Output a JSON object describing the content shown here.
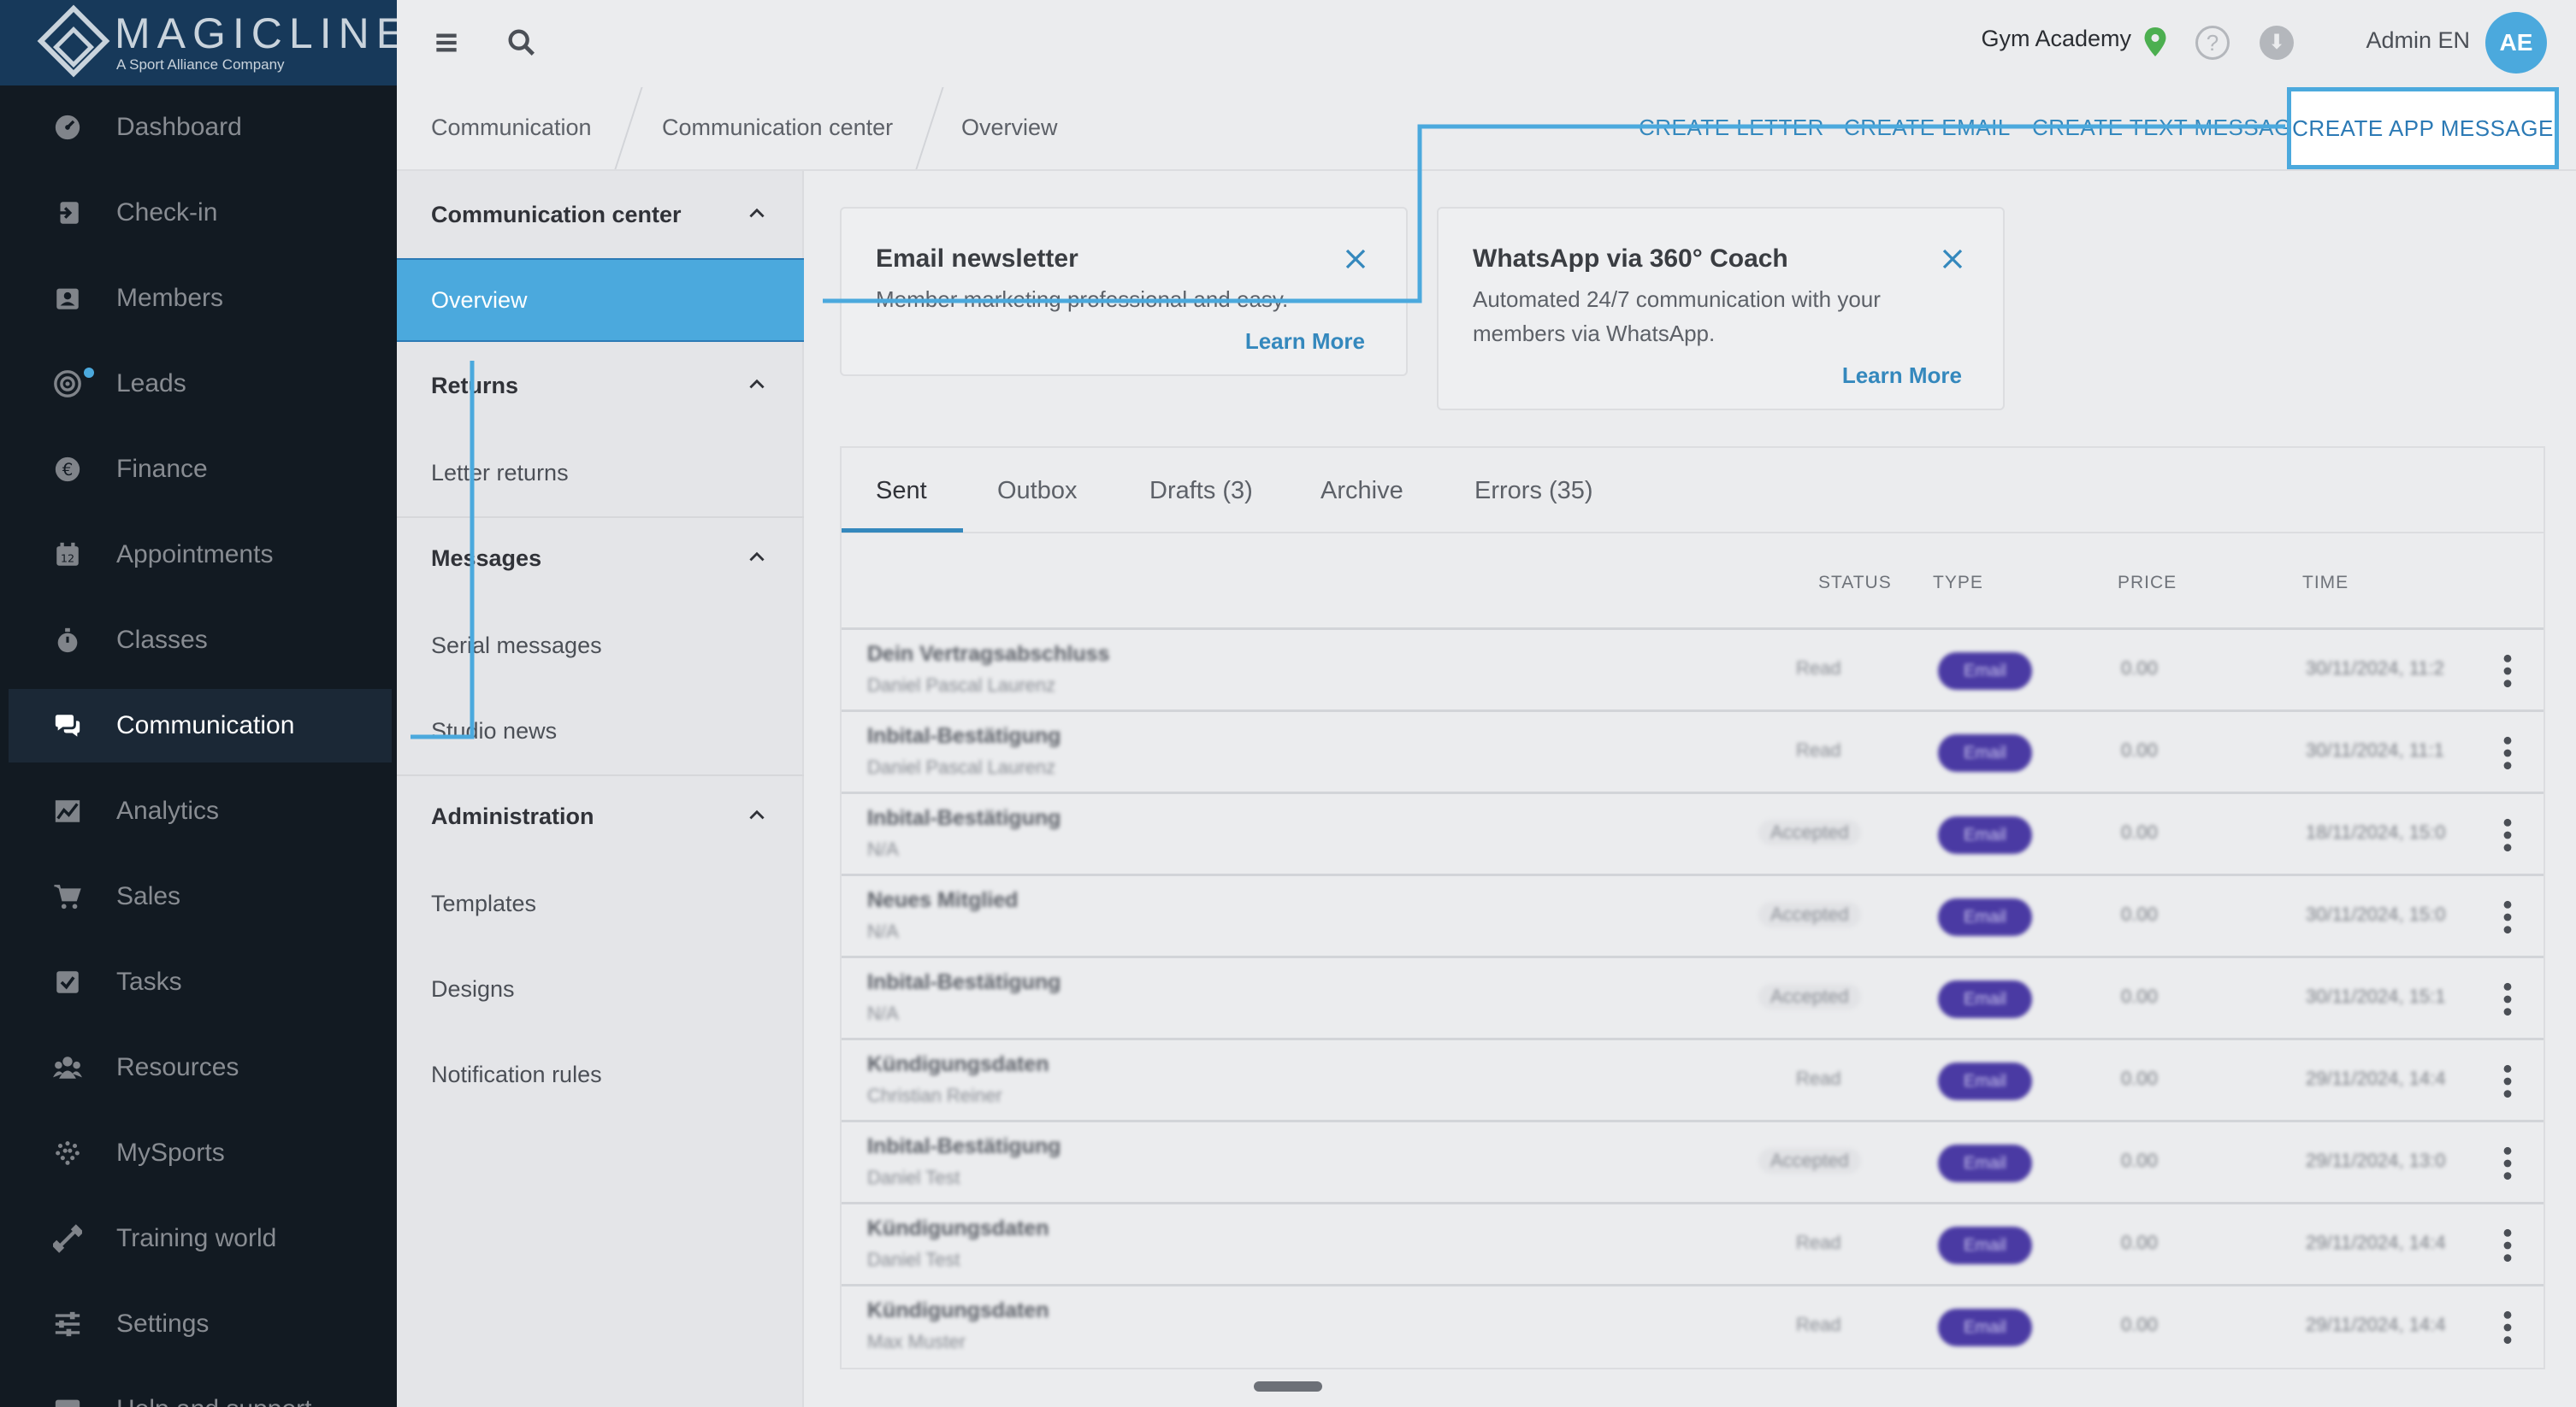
{
  "app": {
    "logo_name": "MAGICLINE",
    "logo_tagline": "A Sport Alliance Company"
  },
  "sidebar": {
    "items": [
      {
        "label": "Dashboard",
        "icon": "dashboard-icon"
      },
      {
        "label": "Check-in",
        "icon": "check-in-icon"
      },
      {
        "label": "Members",
        "icon": "members-icon"
      },
      {
        "label": "Leads",
        "icon": "leads-icon"
      },
      {
        "label": "Finance",
        "icon": "euro-icon"
      },
      {
        "label": "Appointments",
        "icon": "calendar-icon"
      },
      {
        "label": "Classes",
        "icon": "stopwatch-icon"
      },
      {
        "label": "Communication",
        "icon": "chat-icon"
      },
      {
        "label": "Analytics",
        "icon": "chart-icon"
      },
      {
        "label": "Sales",
        "icon": "cart-icon"
      },
      {
        "label": "Tasks",
        "icon": "checkbox-icon"
      },
      {
        "label": "Resources",
        "icon": "people-icon"
      },
      {
        "label": "MySports",
        "icon": "dots-grid-icon"
      },
      {
        "label": "Training world",
        "icon": "dumbbell-icon"
      },
      {
        "label": "Settings",
        "icon": "sliders-icon"
      },
      {
        "label": "Help and support",
        "icon": "help-icon"
      }
    ],
    "active": "Communication"
  },
  "topbar": {
    "studio": "Gym Academy",
    "user": "Admin EN",
    "avatar_initials": "AE",
    "help_glyph": "?",
    "download_glyph": "⬇"
  },
  "breadcrumb": [
    "Communication",
    "Communication center",
    "Overview"
  ],
  "actions": {
    "create_letter": "CREATE LETTER",
    "create_email": "CREATE EMAIL",
    "create_text": "CREATE TEXT MESSAGE",
    "create_app": "CREATE APP MESSAGE"
  },
  "subnav": {
    "sections": [
      {
        "title": "Communication center",
        "items": [
          "Overview"
        ]
      },
      {
        "title": "Returns",
        "items": [
          "Letter returns"
        ]
      },
      {
        "title": "Messages",
        "items": [
          "Serial messages",
          "Studio news"
        ]
      },
      {
        "title": "Administration",
        "items": [
          "Templates",
          "Designs",
          "Notification rules"
        ]
      }
    ],
    "selected": "Overview"
  },
  "cards": [
    {
      "title": "Email newsletter",
      "body": "Member marketing professional and easy.",
      "link": "Learn More"
    },
    {
      "title": "WhatsApp via 360° Coach",
      "body": "Automated 24/7 communication with your members via WhatsApp.",
      "link": "Learn More"
    }
  ],
  "tabs": [
    "Sent",
    "Outbox",
    "Drafts (3)",
    "Archive",
    "Errors (35)"
  ],
  "table": {
    "columns": [
      "STATUS",
      "TYPE",
      "PRICE",
      "TIME"
    ],
    "rows": [
      {
        "title": "Dein Vertragsabschluss",
        "recipient": "Daniel Pascal Laurenz",
        "status": "Read",
        "type": "Email",
        "price": "0.00",
        "time": "30/11/2024, 11:2"
      },
      {
        "title": "Inbital-Bestätigung",
        "recipient": "Daniel Pascal Laurenz",
        "status": "Read",
        "type": "Email",
        "price": "0.00",
        "time": "30/11/2024, 11:1"
      },
      {
        "title": "Inbital-Bestätigung",
        "recipient": "N/A",
        "status": "Accepted",
        "type": "Email",
        "price": "0.00",
        "time": "18/11/2024, 15:0"
      },
      {
        "title": "Neues Mitglied",
        "recipient": "N/A",
        "status": "Accepted",
        "type": "Email",
        "price": "0.00",
        "time": "30/11/2024, 15:0"
      },
      {
        "title": "Inbital-Bestätigung",
        "recipient": "N/A",
        "status": "Accepted",
        "type": "Email",
        "price": "0.00",
        "time": "30/11/2024, 15:1"
      },
      {
        "title": "Kündigungsdaten",
        "recipient": "Christian Reiner",
        "status": "Read",
        "type": "Email",
        "price": "0.00",
        "time": "29/11/2024, 14:4"
      },
      {
        "title": "Inbital-Bestätigung",
        "recipient": "Daniel Test",
        "status": "Accepted",
        "type": "Email",
        "price": "0.00",
        "time": "29/11/2024, 13:0"
      },
      {
        "title": "Kündigungsdaten",
        "recipient": "Daniel Test",
        "status": "Read",
        "type": "Email",
        "price": "0.00",
        "time": "29/11/2024, 14:4"
      },
      {
        "title": "Kündigungsdaten",
        "recipient": "Max Muster",
        "status": "Read",
        "type": "Email",
        "price": "0.00",
        "time": "29/11/2024, 14:4"
      }
    ]
  },
  "colors": {
    "accent": "#4ba9dd",
    "sidebar_bg": "#121a22",
    "link": "#3488bd",
    "badge": "#4a3aa3"
  }
}
